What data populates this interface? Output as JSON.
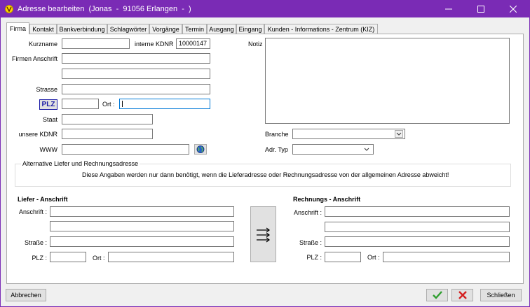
{
  "window": {
    "title": "Adresse bearbeiten  (Jonas  -  91056 Erlangen  -  )",
    "accent_color": "#7a2bb5"
  },
  "tabs": [
    "Firma",
    "Kontakt",
    "Bankverbindung",
    "Schlagwörter",
    "Vorgänge",
    "Termin",
    "Ausgang",
    "Eingang",
    "Kunden - Informations - Zentrum (KIZ)"
  ],
  "active_tab": "Firma",
  "firma": {
    "kurzname_label": "Kurzname",
    "kurzname_value": "",
    "interne_kdnr_label": "interne KDNR",
    "interne_kdnr_value": "10000147",
    "notiz_label": "Notiz",
    "firmen_anschrift_label": "Firmen Anschrift",
    "strasse_label": "Strasse",
    "plz_button": "PLZ",
    "ort_label": "Ort :",
    "staat_label": "Staat",
    "unsere_kdnr_label": "unsere KDNR",
    "www_label": "WWW",
    "branche_label": "Branche",
    "adr_typ_label": "Adr. Typ"
  },
  "alt_address": {
    "group_title": "Alternative Liefer und Rechnungsadresse",
    "info_text": "Diese Angaben werden nur dann benötigt, wenn die Lieferadresse oder Rechnungsadresse  von der allgemeinen Adresse abweicht!"
  },
  "liefer": {
    "heading": "Liefer - Anschrift",
    "anschrift_label": "Anschrift :",
    "strasse_label": "Straße :",
    "plz_label": "PLZ :",
    "ort_label": "Ort :"
  },
  "rechnung": {
    "heading": "Rechnungs - Anschrift",
    "anschrift_label": "Anschrift :",
    "strasse_label": "Straße :",
    "plz_label": "PLZ :",
    "ort_label": "Ort :"
  },
  "footer": {
    "cancel_label": "Abbrechen",
    "close_label": "Schließen",
    "ok_color": "#2e9e2e",
    "delete_color": "#d42020"
  }
}
